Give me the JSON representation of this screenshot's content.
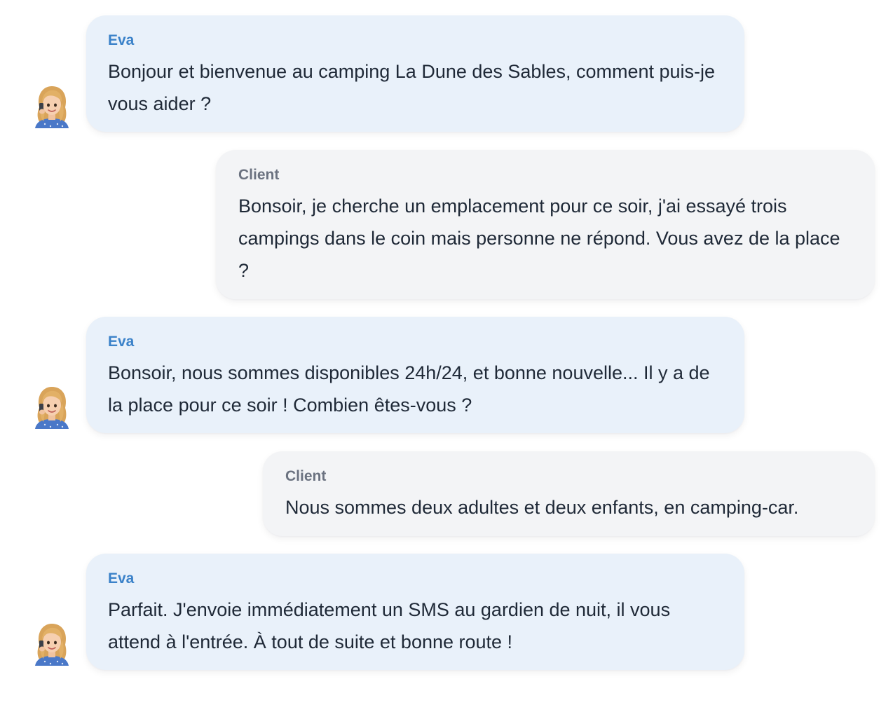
{
  "messages": [
    {
      "sender": "Eva",
      "role": "agent",
      "text": "Bonjour et bienvenue au camping La Dune des Sables, comment puis-je vous aider ?"
    },
    {
      "sender": "Client",
      "role": "user",
      "text": "Bonsoir, je cherche un emplacement pour ce soir, j'ai essayé trois campings dans le coin mais personne ne répond. Vous avez de la place ?"
    },
    {
      "sender": "Eva",
      "role": "agent",
      "text": "Bonsoir, nous sommes disponibles 24h/24, et bonne nouvelle... Il y a de la place pour ce soir ! Combien êtes-vous ?"
    },
    {
      "sender": "Client",
      "role": "user",
      "text": "Nous sommes deux adultes et deux enfants, en camping-car."
    },
    {
      "sender": "Eva",
      "role": "agent",
      "text": "Parfait. J'envoie immédiatement un SMS au gardien de nuit, il vous attend à l'entrée. À tout de suite et bonne route !"
    }
  ],
  "colors": {
    "agent_bubble": "#e9f1fa",
    "user_bubble": "#f3f4f6",
    "agent_name": "#3b82c9",
    "user_name": "#6b7280",
    "text": "#1f2937"
  }
}
